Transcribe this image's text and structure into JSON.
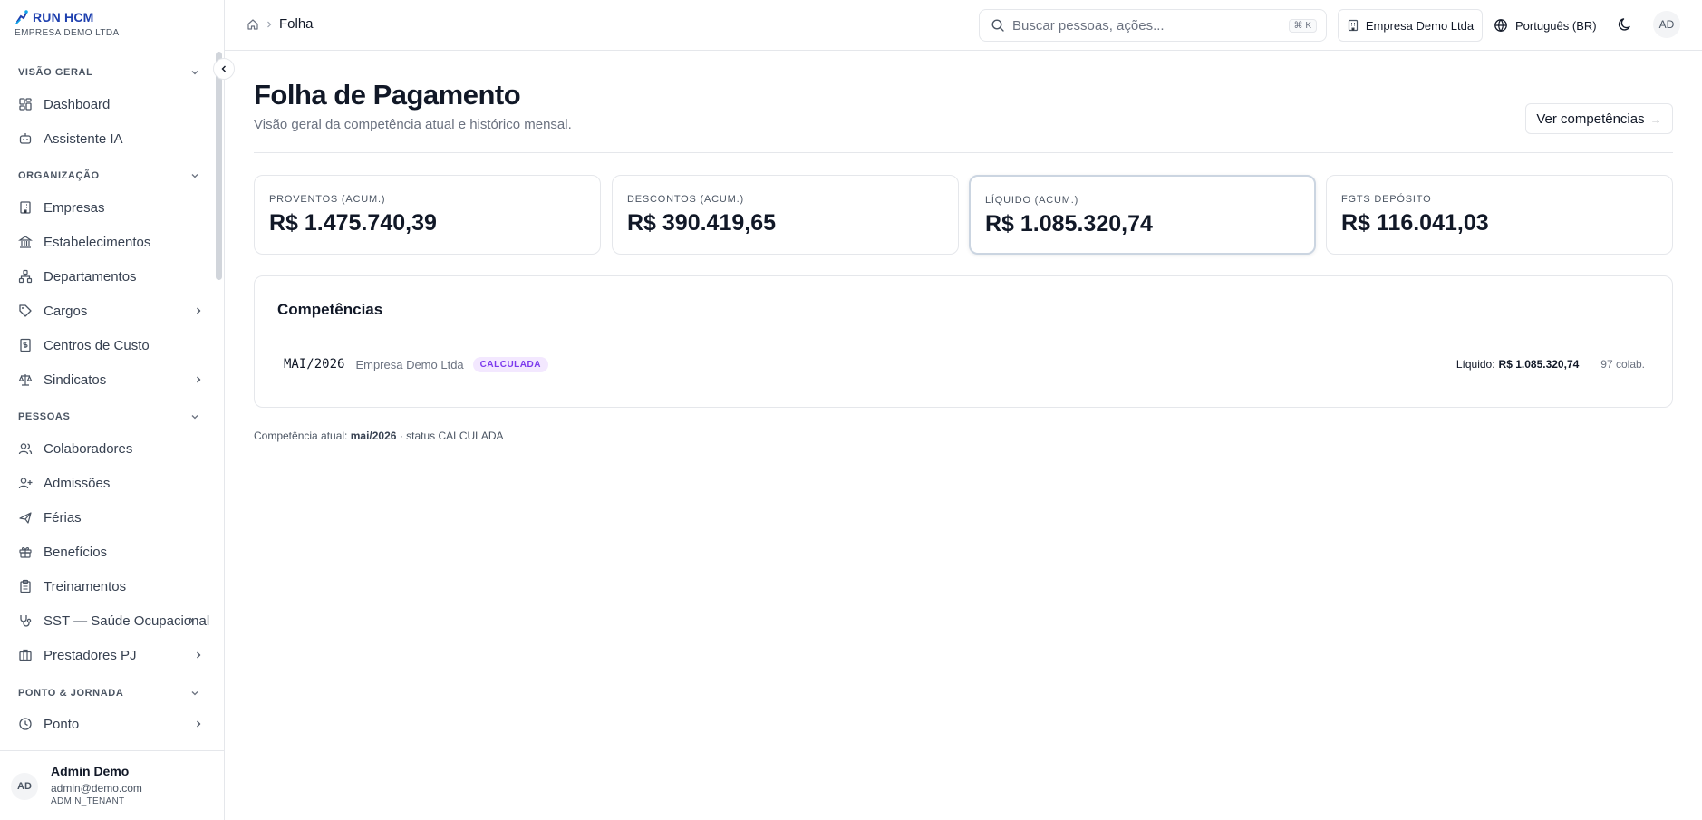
{
  "app": {
    "brand_name": "RUN HCM",
    "company_sub": "EMPRESA DEMO LTDA"
  },
  "sidebar": {
    "sections": [
      {
        "title": "VISÃO GERAL",
        "items": [
          {
            "label": "Dashboard",
            "icon": "dashboard-icon"
          },
          {
            "label": "Assistente IA",
            "icon": "bot-icon"
          }
        ]
      },
      {
        "title": "ORGANIZAÇÃO",
        "items": [
          {
            "label": "Empresas",
            "icon": "building-icon"
          },
          {
            "label": "Estabelecimentos",
            "icon": "landmark-icon"
          },
          {
            "label": "Departamentos",
            "icon": "org-chart-icon"
          },
          {
            "label": "Cargos",
            "icon": "tag-icon",
            "expandable": true
          },
          {
            "label": "Centros de Custo",
            "icon": "receipt-icon"
          },
          {
            "label": "Sindicatos",
            "icon": "scale-icon",
            "expandable": true
          }
        ]
      },
      {
        "title": "PESSOAS",
        "items": [
          {
            "label": "Colaboradores",
            "icon": "users-icon"
          },
          {
            "label": "Admissões",
            "icon": "user-plus-icon"
          },
          {
            "label": "Férias",
            "icon": "plane-icon"
          },
          {
            "label": "Benefícios",
            "icon": "gift-icon"
          },
          {
            "label": "Treinamentos",
            "icon": "clipboard-icon"
          },
          {
            "label": "SST — Saúde Ocupacional",
            "icon": "stethoscope-icon",
            "expandable": true
          },
          {
            "label": "Prestadores PJ",
            "icon": "briefcase-icon",
            "expandable": true
          }
        ]
      },
      {
        "title": "PONTO & JORNADA",
        "items": [
          {
            "label": "Ponto",
            "icon": "clock-icon",
            "expandable": true
          }
        ]
      }
    ],
    "user": {
      "initials": "AD",
      "name": "Admin Demo",
      "email": "admin@demo.com",
      "role": "ADMIN_TENANT"
    }
  },
  "topbar": {
    "breadcrumb": "Folha",
    "search_placeholder": "Buscar pessoas, ações...",
    "search_shortcut": "⌘ K",
    "company": "Empresa Demo Ltda",
    "language": "Português (BR)",
    "avatar_initials": "AD"
  },
  "main": {
    "title": "Folha de Pagamento",
    "subtitle": "Visão geral da competência atual e histórico mensal.",
    "ver_button": "Ver competências",
    "ver_arrow": "→",
    "stats": [
      {
        "label": "PROVENTOS (ACUM.)",
        "value": "R$ 1.475.740,39"
      },
      {
        "label": "DESCONTOS (ACUM.)",
        "value": "R$ 390.419,65"
      },
      {
        "label": "LÍQUIDO (ACUM.)",
        "value": "R$ 1.085.320,74"
      },
      {
        "label": "FGTS DEPÓSITO",
        "value": "R$ 116.041,03"
      }
    ],
    "competencias": {
      "title": "Competências",
      "rows": [
        {
          "period": "MAI/2026",
          "company": "Empresa Demo Ltda",
          "status": "CALCULADA",
          "liquido_label": "Líquido:",
          "liquido_value": "R$ 1.085.320,74",
          "colab": "97 colab."
        }
      ]
    },
    "footnote": {
      "prefix": "Competência atual:",
      "period": "mai/2026",
      "suffix": "· status CALCULADA"
    }
  },
  "colors": {
    "brand": "#1e40af",
    "badge_text": "#7c3aed",
    "badge_bg": "#f3e8ff",
    "border": "#e5e7eb"
  }
}
